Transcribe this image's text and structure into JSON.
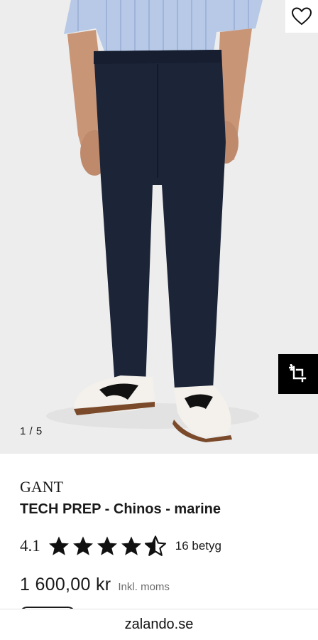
{
  "gallery": {
    "counter": "1 / 5",
    "colors": {
      "background": "#ededed",
      "pants": "#1c2538",
      "shirt": "#b7c9e6"
    }
  },
  "icons": {
    "wishlist": "heart-outline-icon",
    "tryon": "crop-plus-icon"
  },
  "product": {
    "brand": "GANT",
    "title": "TECH PREP - Chinos - marine",
    "rating": "4.1",
    "rating_value": 4.1,
    "rating_max": 5,
    "rating_count": "16 betyg",
    "price": "1 600,00 kr",
    "price_note": "Inkl. moms"
  },
  "browser": {
    "url": "zalando.se"
  }
}
